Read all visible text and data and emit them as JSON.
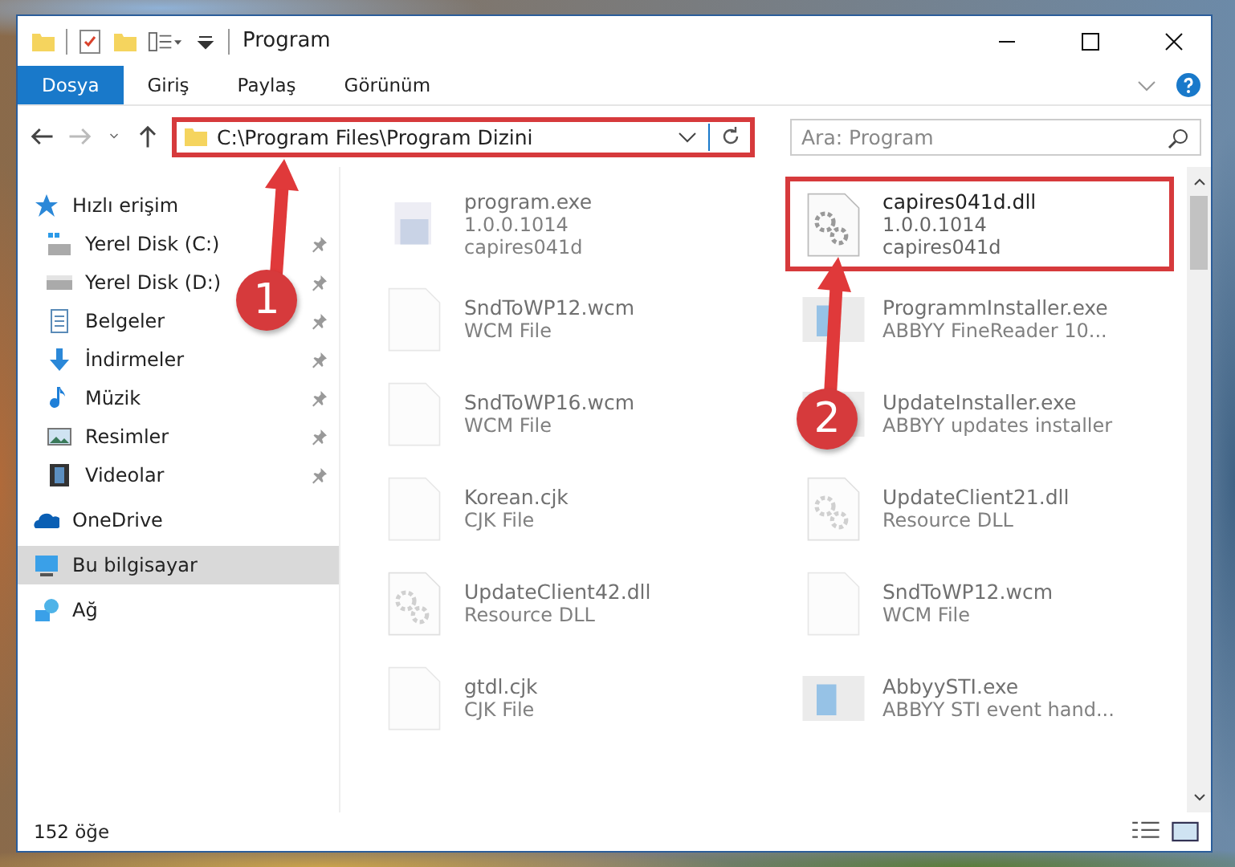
{
  "window": {
    "title": "Program"
  },
  "ribbon_tabs": [
    {
      "label": "Dosya",
      "selected": true
    },
    {
      "label": "Giriş",
      "selected": false
    },
    {
      "label": "Paylaş",
      "selected": false
    },
    {
      "label": "Görünüm",
      "selected": false
    }
  ],
  "address_bar": {
    "path": "C:\\Program Files\\Program Dizini",
    "highlighted": true
  },
  "search": {
    "placeholder": "Ara: Program"
  },
  "sidebar": {
    "items": [
      {
        "label": "Hızlı erişim",
        "kind": "star",
        "selected": false,
        "children": [
          {
            "label": "Yerel Disk (C:)",
            "kind": "drive-c",
            "pinned": true,
            "selected": false
          },
          {
            "label": "Yerel Disk (D:)",
            "kind": "drive",
            "pinned": true,
            "selected": false
          },
          {
            "label": "Belgeler",
            "kind": "docs",
            "pinned": true,
            "selected": false
          },
          {
            "label": "İndirmeler",
            "kind": "download",
            "pinned": true,
            "selected": false
          },
          {
            "label": "Müzik",
            "kind": "music",
            "pinned": true,
            "selected": false
          },
          {
            "label": "Resimler",
            "kind": "pictures",
            "pinned": true,
            "selected": false
          },
          {
            "label": "Videolar",
            "kind": "videos",
            "pinned": true,
            "selected": false
          }
        ]
      },
      {
        "label": "OneDrive",
        "kind": "cloud",
        "selected": false
      },
      {
        "label": "Bu bilgisayar",
        "kind": "pc",
        "selected": true
      },
      {
        "label": "Ağ",
        "kind": "network",
        "selected": false
      }
    ]
  },
  "files": [
    {
      "name": "program.exe",
      "details": [
        "1.0.0.1014",
        "capires041d"
      ],
      "kind": "exe",
      "blurred": true,
      "highlighted": false
    },
    {
      "name": "capires041d.dll",
      "details": [
        "1.0.0.1014",
        "capires041d"
      ],
      "kind": "dll",
      "blurred": false,
      "highlighted": true
    },
    {
      "name": "SndToWP12.wcm",
      "details": [
        "WCM File"
      ],
      "kind": "doc",
      "blurred": true,
      "highlighted": false
    },
    {
      "name": "ProgrammInstaller.exe",
      "details": [
        "ABBYY FineReader 10..."
      ],
      "kind": "installer",
      "blurred": true,
      "highlighted": false
    },
    {
      "name": "SndToWP16.wcm",
      "details": [
        "WCM File"
      ],
      "kind": "doc",
      "blurred": true,
      "highlighted": false
    },
    {
      "name": "UpdateInstaller.exe",
      "details": [
        "ABBYY updates installer"
      ],
      "kind": "installer",
      "blurred": true,
      "highlighted": false
    },
    {
      "name": "Korean.cjk",
      "details": [
        "CJK File"
      ],
      "kind": "doc",
      "blurred": true,
      "highlighted": false
    },
    {
      "name": "UpdateClient21.dll",
      "details": [
        "Resource DLL"
      ],
      "kind": "dll",
      "blurred": true,
      "highlighted": false
    },
    {
      "name": "UpdateClient42.dll",
      "details": [
        "Resource DLL"
      ],
      "kind": "dll",
      "blurred": true,
      "highlighted": false
    },
    {
      "name": "SndToWP12.wcm",
      "details": [
        "WCM File"
      ],
      "kind": "doc",
      "blurred": true,
      "highlighted": false
    },
    {
      "name": "gtdl.cjk",
      "details": [
        "CJK File"
      ],
      "kind": "doc",
      "blurred": true,
      "highlighted": false
    },
    {
      "name": "AbbyySTI.exe",
      "details": [
        "ABBYY STI event hand..."
      ],
      "kind": "installer",
      "blurred": true,
      "highlighted": false
    }
  ],
  "status_bar": {
    "count": "152 öğe"
  },
  "annotations": [
    {
      "label": "1"
    },
    {
      "label": "2"
    }
  ]
}
